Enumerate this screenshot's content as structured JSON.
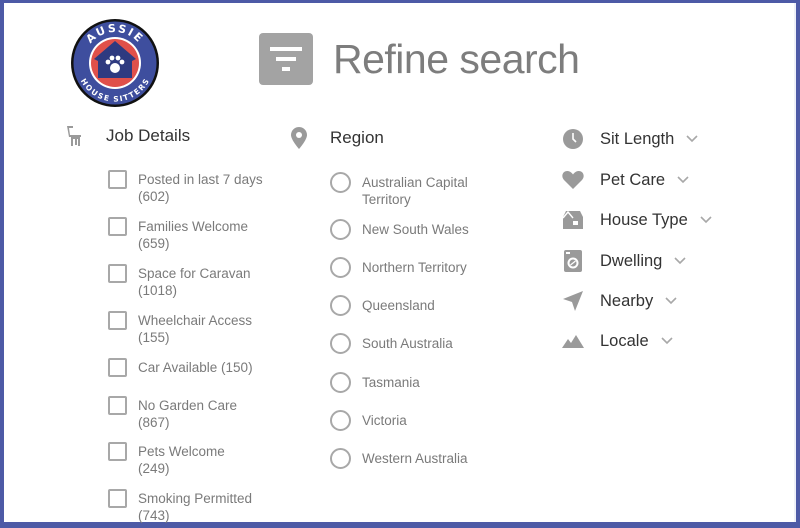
{
  "brand": {
    "logo_text_top": "AUSSIE",
    "logo_text_bottom": "HOUSE SITTERS",
    "colors": {
      "navy": "#3e4e9e",
      "red": "#e0504a",
      "frame": "#4d5aa6"
    }
  },
  "header": {
    "icon": "filter-icon",
    "title": "Refine search"
  },
  "job_details": {
    "icon": "chair-icon",
    "title": "Job Details",
    "options": [
      {
        "label": "Posted in last 7 days (602)",
        "checked": false
      },
      {
        "label": "Families Welcome (659)",
        "checked": false
      },
      {
        "label": "Space for Caravan (1018)",
        "checked": false
      },
      {
        "label": "Wheelchair Access (155)",
        "checked": false
      },
      {
        "label": "Car Available (150)",
        "checked": false
      },
      {
        "label": "No Garden Care (867)",
        "checked": false
      },
      {
        "label": "Pets Welcome (249)",
        "checked": false
      },
      {
        "label": "Smoking Permitted (743)",
        "checked": false
      }
    ]
  },
  "region": {
    "icon": "map-pin-icon",
    "title": "Region",
    "options": [
      {
        "label": "Australian Capital Territory",
        "selected": false
      },
      {
        "label": "New South Wales",
        "selected": false
      },
      {
        "label": "Northern Territory",
        "selected": false
      },
      {
        "label": "Queensland",
        "selected": false
      },
      {
        "label": "South Australia",
        "selected": false
      },
      {
        "label": "Tasmania",
        "selected": false
      },
      {
        "label": "Victoria",
        "selected": false
      },
      {
        "label": "Western Australia",
        "selected": false
      }
    ]
  },
  "dropdowns": [
    {
      "icon": "clock-icon",
      "label": "Sit Length"
    },
    {
      "icon": "heart-icon",
      "label": "Pet Care"
    },
    {
      "icon": "house-icon",
      "label": "House Type"
    },
    {
      "icon": "dwelling-icon",
      "label": "Dwelling"
    },
    {
      "icon": "navigation-arrow-icon",
      "label": "Nearby"
    },
    {
      "icon": "mountains-icon",
      "label": "Locale"
    }
  ]
}
